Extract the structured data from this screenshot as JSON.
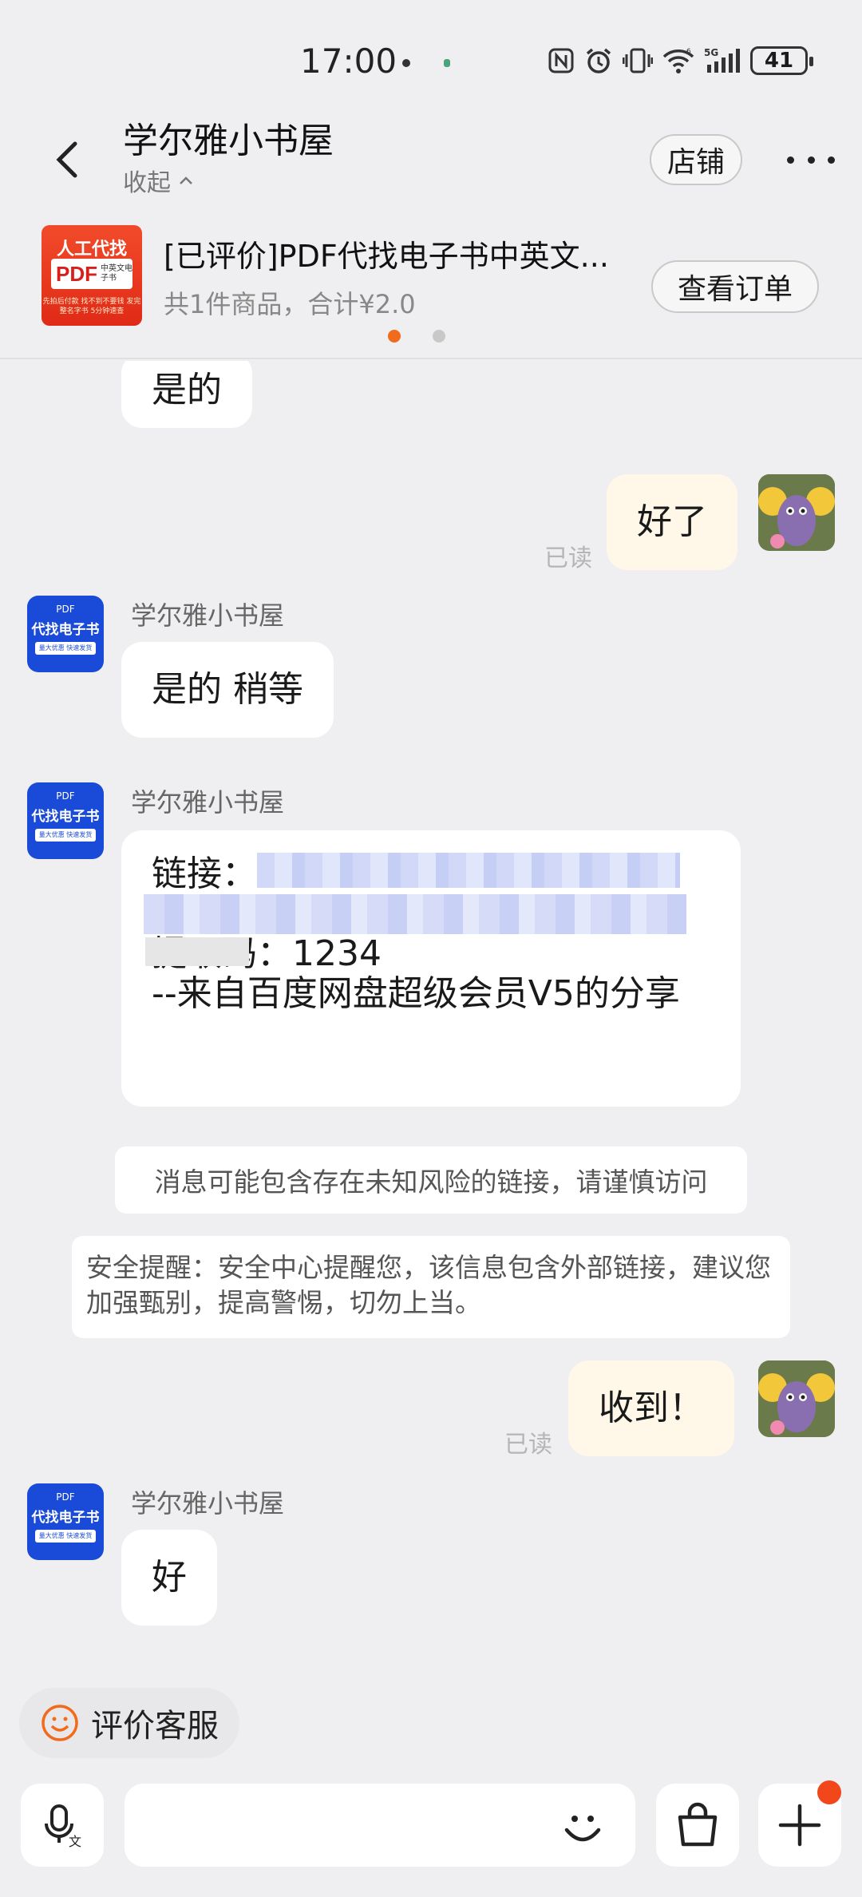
{
  "status_bar": {
    "time": "17:00",
    "network": "5G",
    "battery": "41"
  },
  "header": {
    "title": "学尔雅小书屋",
    "collapse_label": "收起",
    "store_button": "店铺"
  },
  "order": {
    "thumb_top": "人工代找",
    "thumb_pdf": "PDF",
    "thumb_pdf_tag": "中英文电子书",
    "thumb_small": "先拍后付款 找不到不要钱\n发完整名字书 5分钟速查",
    "title": "[已评价]PDF代找电子书中英文...",
    "summary": "共1件商品，合计¥2.0",
    "view_button": "查看订单"
  },
  "shop_avatar": {
    "line1": "PDF",
    "line2": "代找电子书",
    "line3": "量大优惠 快速发货"
  },
  "messages": {
    "m1": "是的",
    "m2": "好了",
    "m2_read": "已读",
    "m3_sender": "学尔雅小书屋",
    "m3": "是的 稍等",
    "m4_sender": "学尔雅小书屋",
    "m4_line1": "链接：",
    "m4_line3": "提取码：1234",
    "m4_line4": "--来自百度网盘超级会员V5的分享",
    "notice1": "消息可能包含存在未知风险的链接，请谨慎访问",
    "notice2": "安全提醒：安全中心提醒您，该信息包含外部链接，建议您加强甄别，提高警惕，切勿上当。",
    "m5": "收到！",
    "m5_read": "已读",
    "m6_sender": "学尔雅小书屋",
    "m6": "好"
  },
  "eval_button": "评价客服",
  "input": {
    "placeholder": ""
  },
  "colors": {
    "accent": "#f26a1b",
    "outgoing_bubble": "#fff8e9",
    "shop_avatar": "#1a4bd8",
    "background": "#efeff1"
  }
}
